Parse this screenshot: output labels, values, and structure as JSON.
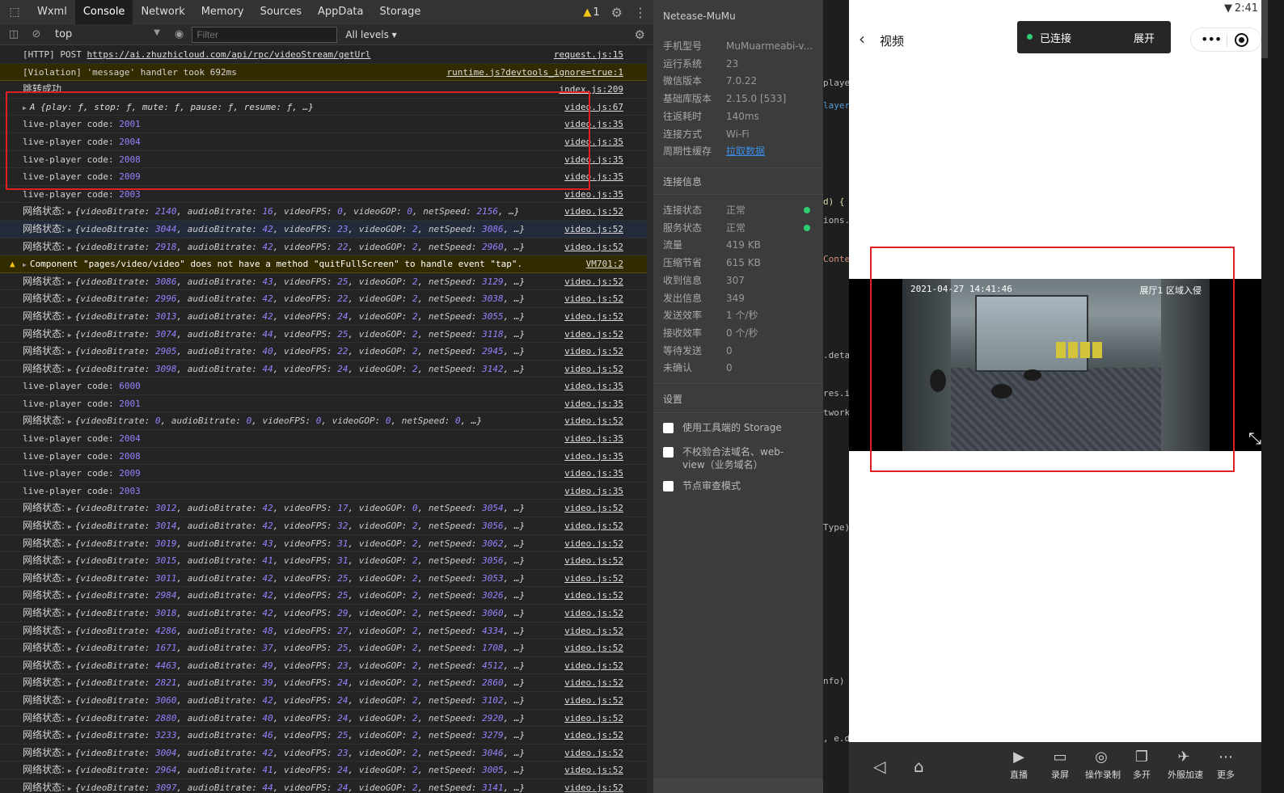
{
  "devtools": {
    "tabs": [
      "Wxml",
      "Console",
      "Network",
      "Memory",
      "Sources",
      "AppData",
      "Storage"
    ],
    "active_tab": "Console",
    "warnings_count": "1",
    "context": "top",
    "filter_placeholder": "Filter",
    "levels": "All levels",
    "logs": [
      {
        "kind": "text",
        "text": "[HTTP] POST ",
        "link": "https://ai.zhuzhicloud.com/api/rpc/videoStream/getUrl",
        "src": "request.js:15"
      },
      {
        "kind": "violation",
        "text": "[Violation] 'message' handler took 692ms",
        "src": "runtime.js?devtools_ignore=true:1"
      },
      {
        "kind": "text",
        "text": "跳转成功",
        "src": "index.js:209"
      },
      {
        "kind": "object",
        "text": "A {play: ƒ, stop: ƒ, mute: ƒ, pause: ƒ, resume: ƒ, …}",
        "src": "video.js:67"
      },
      {
        "kind": "code",
        "code": "2001",
        "src": "video.js:35"
      },
      {
        "kind": "code",
        "code": "2004",
        "src": "video.js:35"
      },
      {
        "kind": "code",
        "code": "2008",
        "src": "video.js:35"
      },
      {
        "kind": "code",
        "code": "2009",
        "src": "video.js:35"
      },
      {
        "kind": "code",
        "code": "2003",
        "src": "video.js:35"
      },
      {
        "kind": "net",
        "v": [
          "2140",
          "16",
          "0",
          "0",
          "2156"
        ],
        "src": "video.js:52"
      },
      {
        "kind": "net",
        "v": [
          "3044",
          "42",
          "23",
          "2",
          "3086"
        ],
        "src": "video.js:52",
        "hl": true
      },
      {
        "kind": "net",
        "v": [
          "2918",
          "42",
          "22",
          "2",
          "2960"
        ],
        "src": "video.js:52"
      },
      {
        "kind": "warn",
        "text": "Component \"pages/video/video\" does not have a method \"quitFullScreen\" to handle event \"tap\".",
        "src": "VM701:2"
      },
      {
        "kind": "net",
        "v": [
          "3086",
          "43",
          "25",
          "2",
          "3129"
        ],
        "src": "video.js:52"
      },
      {
        "kind": "net",
        "v": [
          "2996",
          "42",
          "22",
          "2",
          "3038"
        ],
        "src": "video.js:52"
      },
      {
        "kind": "net",
        "v": [
          "3013",
          "42",
          "24",
          "2",
          "3055"
        ],
        "src": "video.js:52"
      },
      {
        "kind": "net",
        "v": [
          "3074",
          "44",
          "25",
          "2",
          "3118"
        ],
        "src": "video.js:52"
      },
      {
        "kind": "net",
        "v": [
          "2905",
          "40",
          "22",
          "2",
          "2945"
        ],
        "src": "video.js:52"
      },
      {
        "kind": "net",
        "v": [
          "3098",
          "44",
          "24",
          "2",
          "3142"
        ],
        "src": "video.js:52"
      },
      {
        "kind": "code",
        "code": "6000",
        "src": "video.js:35"
      },
      {
        "kind": "code",
        "code": "2001",
        "src": "video.js:35"
      },
      {
        "kind": "net0",
        "v": [
          "0",
          "0",
          "0",
          "0",
          "0"
        ],
        "src": "video.js:52"
      },
      {
        "kind": "code",
        "code": "2004",
        "src": "video.js:35"
      },
      {
        "kind": "code",
        "code": "2008",
        "src": "video.js:35"
      },
      {
        "kind": "code",
        "code": "2009",
        "src": "video.js:35"
      },
      {
        "kind": "code",
        "code": "2003",
        "src": "video.js:35"
      },
      {
        "kind": "net",
        "v": [
          "3012",
          "42",
          "17",
          "0",
          "3054"
        ],
        "src": "video.js:52"
      },
      {
        "kind": "net",
        "v": [
          "3014",
          "42",
          "32",
          "2",
          "3056"
        ],
        "src": "video.js:52"
      },
      {
        "kind": "net",
        "v": [
          "3019",
          "43",
          "31",
          "2",
          "3062"
        ],
        "src": "video.js:52"
      },
      {
        "kind": "net",
        "v": [
          "3015",
          "41",
          "31",
          "2",
          "3056"
        ],
        "src": "video.js:52"
      },
      {
        "kind": "net",
        "v": [
          "3011",
          "42",
          "25",
          "2",
          "3053"
        ],
        "src": "video.js:52"
      },
      {
        "kind": "net",
        "v": [
          "2984",
          "42",
          "25",
          "2",
          "3026"
        ],
        "src": "video.js:52"
      },
      {
        "kind": "net",
        "v": [
          "3018",
          "42",
          "29",
          "2",
          "3060"
        ],
        "src": "video.js:52"
      },
      {
        "kind": "net",
        "v": [
          "4286",
          "48",
          "27",
          "2",
          "4334"
        ],
        "src": "video.js:52"
      },
      {
        "kind": "net",
        "v": [
          "1671",
          "37",
          "25",
          "2",
          "1708"
        ],
        "src": "video.js:52"
      },
      {
        "kind": "net",
        "v": [
          "4463",
          "49",
          "23",
          "2",
          "4512"
        ],
        "src": "video.js:52"
      },
      {
        "kind": "net",
        "v": [
          "2821",
          "39",
          "24",
          "2",
          "2860"
        ],
        "src": "video.js:52"
      },
      {
        "kind": "net",
        "v": [
          "3060",
          "42",
          "24",
          "2",
          "3102"
        ],
        "src": "video.js:52"
      },
      {
        "kind": "net",
        "v": [
          "2880",
          "40",
          "24",
          "2",
          "2920"
        ],
        "src": "video.js:52"
      },
      {
        "kind": "net",
        "v": [
          "3233",
          "46",
          "25",
          "2",
          "3279"
        ],
        "src": "video.js:52"
      },
      {
        "kind": "net",
        "v": [
          "3004",
          "42",
          "23",
          "2",
          "3046"
        ],
        "src": "video.js:52"
      },
      {
        "kind": "net",
        "v": [
          "2964",
          "41",
          "24",
          "2",
          "3005"
        ],
        "src": "video.js:52"
      },
      {
        "kind": "net",
        "v": [
          "3097",
          "44",
          "24",
          "2",
          "3141"
        ],
        "src": "video.js:52"
      }
    ],
    "labels": {
      "code_prefix": "live-player code: ",
      "net_prefix": "网络状态: ",
      "k_vb": "videoBitrate",
      "k_ab": "audioBitrate",
      "k_fps": "videoFPS",
      "k_gop": "videoGOP",
      "k_ns": "netSpeed",
      "ellipsis": "…"
    }
  },
  "device_info": {
    "title": "Netease-MuMu",
    "rows": [
      {
        "k": "手机型号",
        "v": "MuMuarmeabi-v..."
      },
      {
        "k": "运行系统",
        "v": "23"
      },
      {
        "k": "微信版本",
        "v": "7.0.22"
      },
      {
        "k": "基础库版本",
        "v": "2.15.0 [533]"
      },
      {
        "k": "往返耗时",
        "v": "140ms"
      },
      {
        "k": "连接方式",
        "v": "Wi-Fi"
      },
      {
        "k": "周期性缓存",
        "v": "拉取数据",
        "link": true
      }
    ],
    "conn_title": "连接信息",
    "conn_rows": [
      {
        "k": "连接状态",
        "v": "正常",
        "dot": true
      },
      {
        "k": "服务状态",
        "v": "正常",
        "dot": true
      },
      {
        "k": "流量",
        "v": "419 KB"
      },
      {
        "k": "压缩节省",
        "v": "615 KB"
      },
      {
        "k": "收到信息",
        "v": "307"
      },
      {
        "k": "发出信息",
        "v": "349"
      },
      {
        "k": "发送效率",
        "v": "1 个/秒"
      },
      {
        "k": "接收效率",
        "v": "0 个/秒"
      },
      {
        "k": "等待发送",
        "v": "0"
      },
      {
        "k": "未确认",
        "v": "0"
      }
    ],
    "settings_title": "设置",
    "settings": [
      "使用工具端的 Storage",
      "不校验合法域名、web-view（业务域名）",
      "节点审查模式"
    ]
  },
  "code_fragments": [
    "playe",
    "layer",
    "d) {",
    "ions.",
    "Conte",
    ".deta",
    "res.i",
    "twork",
    "Type)",
    "nfo)",
    ", e.d"
  ],
  "phone": {
    "time": "2:41",
    "page_title": "视频",
    "connected": "已连接",
    "expand": "展开",
    "video_timestamp": "2021-04-27  14:41:46",
    "video_zone": "展厅1 区域入侵",
    "bottom_items": [
      "直播",
      "录屏",
      "操作录制",
      "多开",
      "外服加速",
      "更多"
    ]
  }
}
